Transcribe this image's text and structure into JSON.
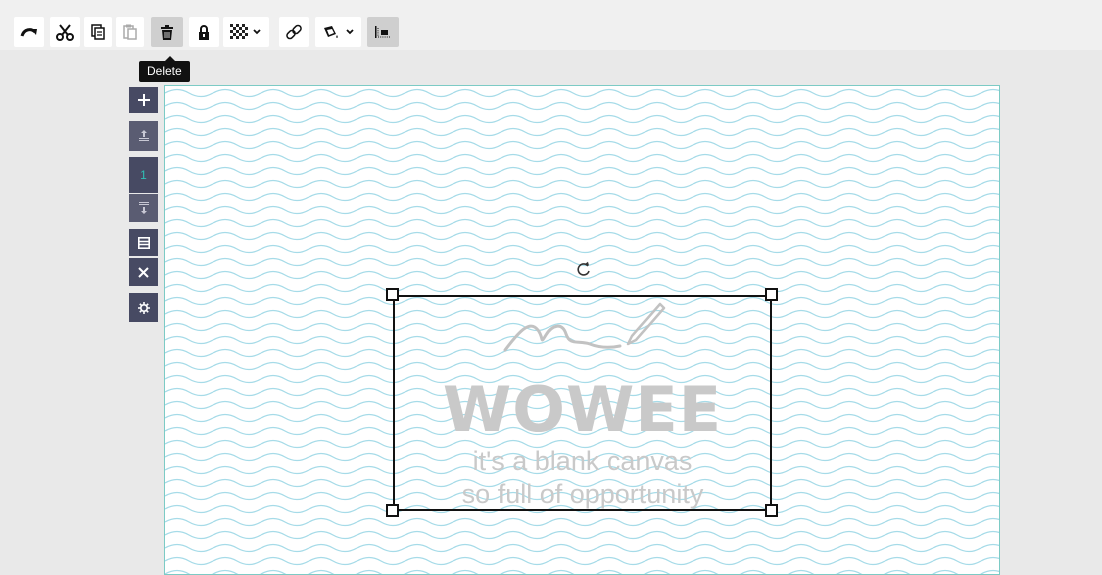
{
  "toolbar": {
    "buttons": [
      {
        "name": "redo-button",
        "icon": "redo-icon"
      },
      {
        "name": "cut-button",
        "icon": "scissors-icon"
      },
      {
        "name": "copy-button",
        "icon": "copy-icon"
      },
      {
        "name": "paste-button",
        "icon": "paste-icon"
      },
      {
        "name": "delete-button",
        "icon": "trash-icon"
      },
      {
        "name": "lock-button",
        "icon": "lock-icon"
      },
      {
        "name": "transparency-dropdown",
        "icon": "checkerboard-icon"
      },
      {
        "name": "link-button",
        "icon": "link-icon"
      },
      {
        "name": "fill-dropdown",
        "icon": "paint-bucket-icon"
      },
      {
        "name": "align-button",
        "icon": "align-icon"
      }
    ],
    "tooltip": "Delete"
  },
  "page_controls": {
    "add_icon": "plus-icon",
    "move_up_icon": "move-up-icon",
    "page_number": "1",
    "move_down_icon": "move-down-icon",
    "layout_icon": "layout-icon",
    "delete_icon": "close-icon",
    "settings_icon": "gear-icon"
  },
  "canvas": {
    "pattern_color": "#a6dbe8",
    "border_color": "#7ccbc5",
    "placeholder": {
      "title": "WOWEE",
      "line1": "it's a blank canvas",
      "line2": "so full of opportunity",
      "text_color": "#c9c9c9"
    }
  }
}
